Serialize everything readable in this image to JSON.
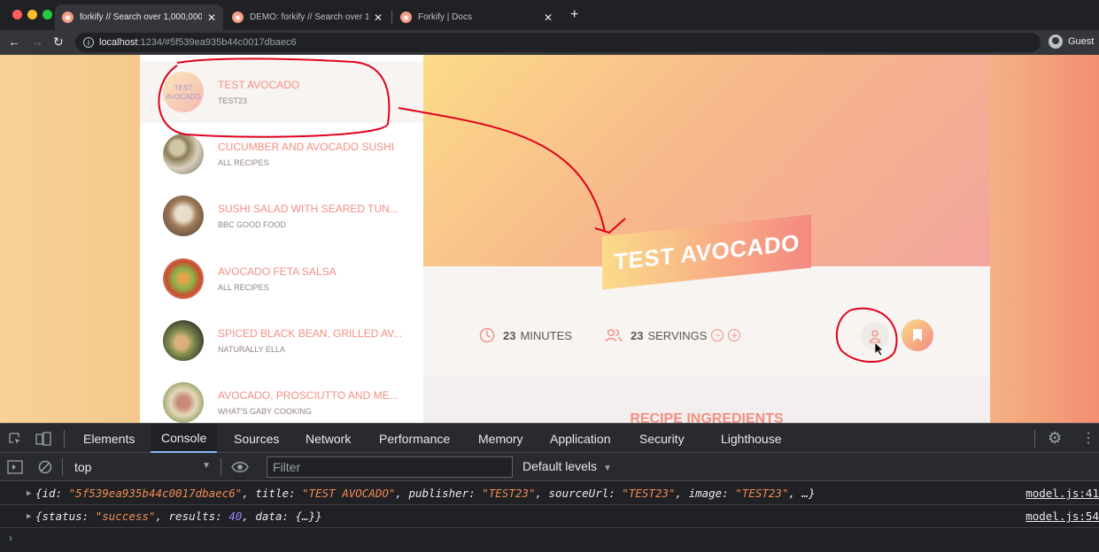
{
  "browser": {
    "tabs": [
      {
        "title": "forkify // Search over 1,000,000",
        "active": true
      },
      {
        "title": "DEMO: forkify // Search over 1,",
        "active": false
      },
      {
        "title": "Forkify | Docs",
        "active": false
      }
    ],
    "url": {
      "host": "localhost",
      "rest": ":1234/#5f539ea935b44c0017dbaec6"
    },
    "profile": "Guest"
  },
  "results": [
    {
      "title": "TEST AVOCADO",
      "publisher": "TEST23",
      "image_alt": "TEST AVOCADO",
      "active": true
    },
    {
      "title": "CUCUMBER AND AVOCADO SUSHI",
      "publisher": "ALL RECIPES"
    },
    {
      "title": "SUSHI SALAD WITH SEARED TUN...",
      "publisher": "BBC GOOD FOOD"
    },
    {
      "title": "AVOCADO FETA SALSA",
      "publisher": "ALL RECIPES"
    },
    {
      "title": "SPICED BLACK BEAN, GRILLED AV...",
      "publisher": "NATURALLY ELLA"
    },
    {
      "title": "AVOCADO, PROSCIUTTO AND ME...",
      "publisher": "WHAT'S GABY COOKING"
    }
  ],
  "recipe": {
    "title": "TEST AVOCADO",
    "minutes": "23",
    "minutes_label": "MINUTES",
    "servings": "23",
    "servings_label": "SERVINGS",
    "ingredients_heading": "RECIPE INGREDIENTS"
  },
  "devtools": {
    "tabs": [
      "Elements",
      "Console",
      "Sources",
      "Network",
      "Performance",
      "Memory",
      "Application",
      "Security",
      "Lighthouse"
    ],
    "active_tab": "Console",
    "context": "top",
    "filter_placeholder": "Filter",
    "levels": "Default levels",
    "logs": [
      {
        "prefix": "{id: ",
        "id": "\"5f539ea935b44c0017dbaec6\"",
        "k2": ", title: ",
        "title": "\"TEST AVOCADO\"",
        "k3": ", publisher: ",
        "publisher": "\"TEST23\"",
        "k4": ", sourceUrl: ",
        "sourceUrl": "\"TEST23\"",
        "k5": ", image: ",
        "image": "\"TEST23\"",
        "suffix": ", …}",
        "source": "model.js:41"
      },
      {
        "prefix": "{status: ",
        "status": "\"success\"",
        "k2": ", results: ",
        "results": "40",
        "suffix": ", data: {…}}",
        "source": "model.js:54"
      }
    ]
  },
  "colors": {
    "accent": "#f38e82",
    "gradient_start": "#fbdb89",
    "gradient_end": "#f48982",
    "annotation": "#e0001b"
  }
}
